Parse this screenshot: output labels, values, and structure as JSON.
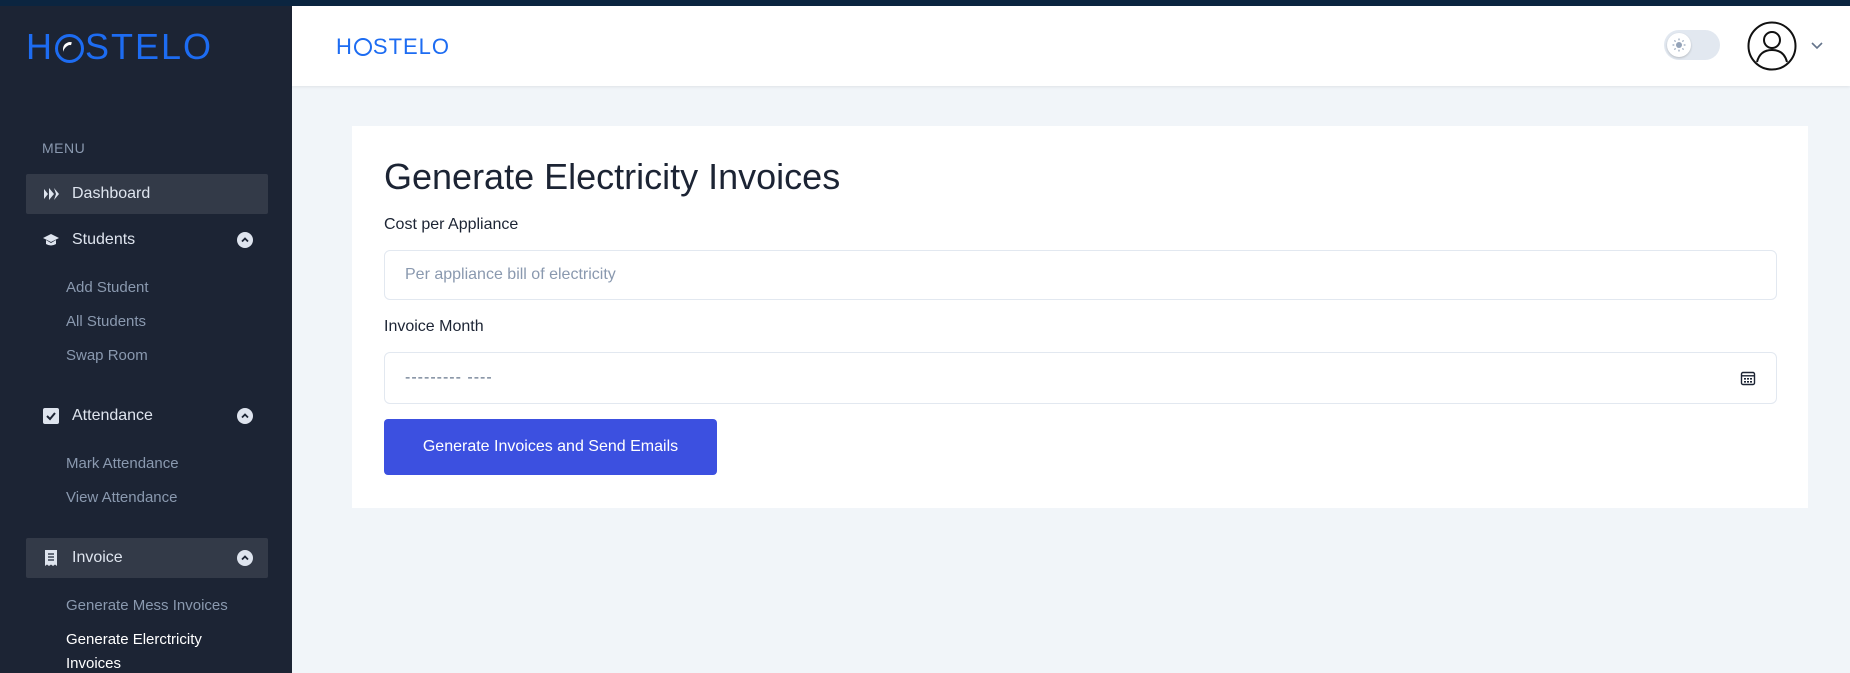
{
  "brand": {
    "name_prefix": "H",
    "name_suffix": "STELO",
    "color": "#1d6cf2"
  },
  "sidebar": {
    "menu_heading": "MENU",
    "items": [
      {
        "label": "Dashboard",
        "icon": "dashboard-icon",
        "active": true
      },
      {
        "label": "Students",
        "icon": "graduation-cap-icon",
        "expanded": true,
        "children": [
          "Add Student",
          "All Students",
          "Swap Room"
        ]
      },
      {
        "label": "Attendance",
        "icon": "checkbox-icon",
        "expanded": true,
        "children": [
          "Mark Attendance",
          "View Attendance"
        ]
      },
      {
        "label": "Invoice",
        "icon": "receipt-icon",
        "expanded": true,
        "active": true,
        "children": [
          "Generate Mess Invoices",
          "Generate Elerctricity Invoices"
        ]
      }
    ]
  },
  "header": {
    "theme_toggle_icon": "sun-icon",
    "avatar_icon": "user-avatar-icon"
  },
  "form": {
    "title": "Generate Electricity Invoices",
    "cost_label": "Cost per Appliance",
    "cost_placeholder": "Per appliance bill of electricity",
    "month_label": "Invoice Month",
    "month_placeholder": "--------- ----",
    "submit_label": "Generate Invoices and Send Emails"
  },
  "colors": {
    "sidebar_bg": "#1c2434",
    "accent": "#3c50e0",
    "page_bg": "#f1f5f9"
  }
}
